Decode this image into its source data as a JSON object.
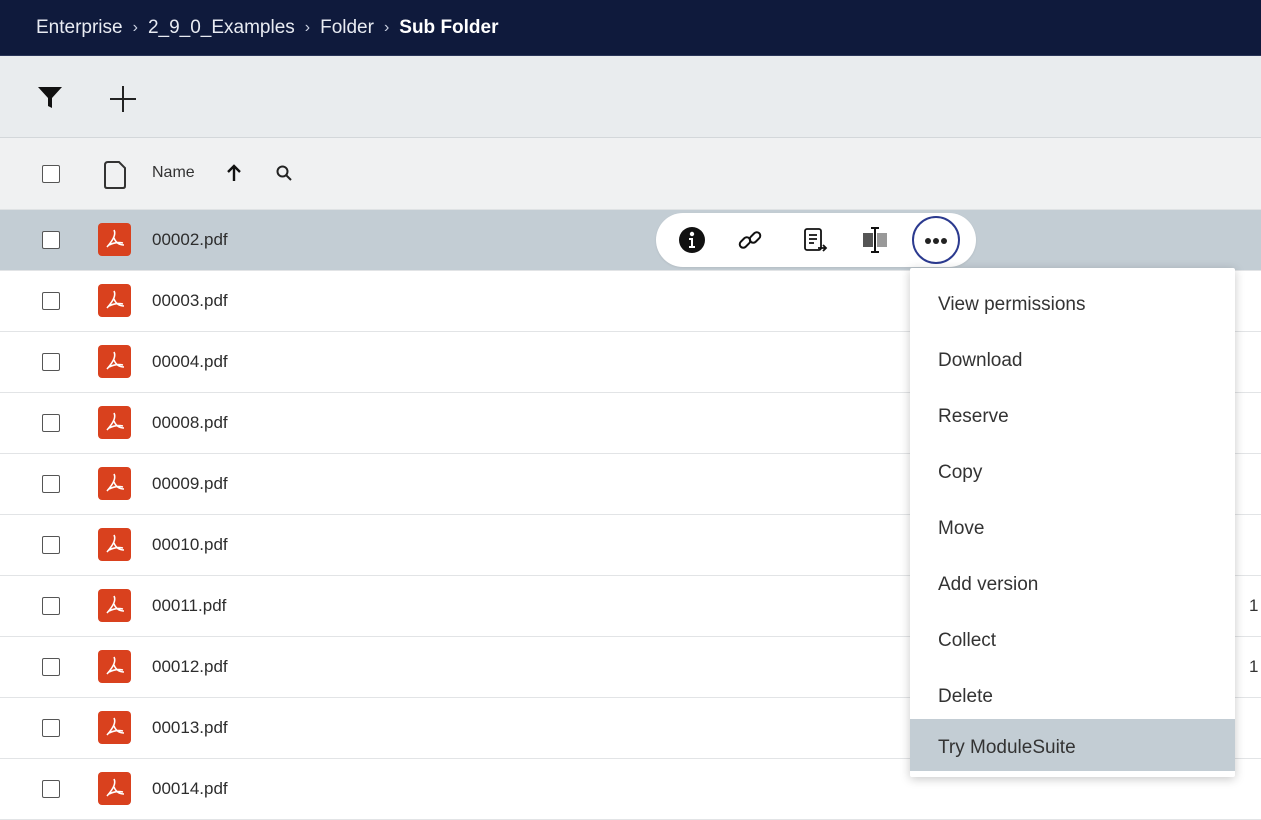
{
  "breadcrumb": {
    "items": [
      "Enterprise",
      "2_9_0_Examples",
      "Folder",
      "Sub Folder"
    ],
    "separator": "›"
  },
  "toolbar": {
    "filter_icon": "filter-icon",
    "add_icon": "plus-icon"
  },
  "list_header": {
    "name_label": "Name",
    "sort_icon": "arrow-up-icon",
    "search_icon": "search-icon"
  },
  "rows": [
    {
      "name": "00002.pdf",
      "selected": true
    },
    {
      "name": "00003.pdf"
    },
    {
      "name": "00004.pdf"
    },
    {
      "name": "00008.pdf"
    },
    {
      "name": "00009.pdf"
    },
    {
      "name": "00010.pdf"
    },
    {
      "name": "00011.pdf",
      "right_text": "1"
    },
    {
      "name": "00012.pdf",
      "right_text": "1"
    },
    {
      "name": "00013.pdf"
    },
    {
      "name": "00014.pdf"
    }
  ],
  "inline_actions": [
    "info-icon",
    "link-icon",
    "properties-icon",
    "compare-icon",
    "more-options-icon"
  ],
  "context_menu": {
    "items": [
      "View permissions",
      "Download",
      "Reserve",
      "Copy",
      "Move",
      "Add version",
      "Collect",
      "Delete",
      "Try ModuleSuite"
    ],
    "active_item": "Try ModuleSuite"
  },
  "colors": {
    "header_bg": "#0f1a3c",
    "toolbar_bg": "#e9ecee",
    "selected_row": "#c3cdd4",
    "pdf_red": "#d9411e",
    "accent": "#2b3a8f"
  }
}
